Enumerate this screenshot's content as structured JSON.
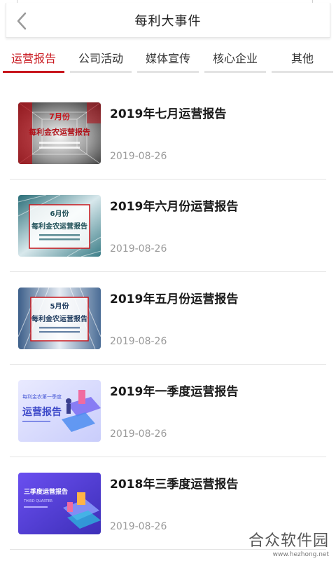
{
  "header": {
    "title": "每利大事件",
    "back_icon": "chevron-left-icon"
  },
  "tabs": [
    {
      "label": "运营报告",
      "active": true
    },
    {
      "label": "公司活动",
      "active": false
    },
    {
      "label": "媒体宣传",
      "active": false
    },
    {
      "label": "核心企业",
      "active": false
    },
    {
      "label": "其他",
      "active": false
    }
  ],
  "colors": {
    "accent": "#c8161d",
    "divider": "#e4e4e4",
    "date": "#9a9a9a"
  },
  "items": [
    {
      "title": "2019年七月运营报告",
      "date": "2019-08-26",
      "thumb": {
        "month": "7月份",
        "headline": "每利金农运营报告",
        "style": "red-tunnel"
      }
    },
    {
      "title": "2019年六月份运营报告",
      "date": "2019-08-26",
      "thumb": {
        "month": "6月份",
        "headline": "每利金农运营报告",
        "style": "teal-building"
      }
    },
    {
      "title": "2019年五月份运营报告",
      "date": "2019-08-26",
      "thumb": {
        "month": "5月份",
        "headline": "每利金农运营报告",
        "style": "blue-building"
      }
    },
    {
      "title": "2019年一季度运营报告",
      "date": "2019-08-26",
      "thumb": {
        "month": "每利金农第一季度",
        "headline": "运营报告",
        "style": "purple-iso"
      }
    },
    {
      "title": "2018年三季度运营报告",
      "date": "2019-08-26",
      "thumb": {
        "month": "三季度运营报告",
        "headline": "THIRD QUARTER",
        "style": "violet-iso"
      }
    }
  ],
  "watermark": {
    "text": "合众软件园",
    "url": "www.hezhong.net"
  }
}
